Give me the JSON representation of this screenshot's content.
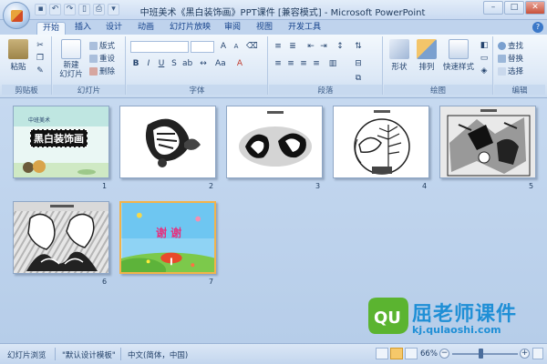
{
  "window": {
    "title": "中班美术《黑白装饰画》PPT课件 [兼容模式] - Microsoft PowerPoint"
  },
  "tabs": [
    {
      "label": "开始",
      "active": true
    },
    {
      "label": "插入"
    },
    {
      "label": "设计"
    },
    {
      "label": "动画"
    },
    {
      "label": "幻灯片放映"
    },
    {
      "label": "审阅"
    },
    {
      "label": "视图"
    },
    {
      "label": "开发工具"
    }
  ],
  "ribbon": {
    "clipboard": {
      "label": "剪贴板",
      "paste": "粘贴"
    },
    "slides": {
      "label": "幻灯片",
      "new_slide": "新建\n幻灯片",
      "layout": "版式",
      "reset": "重设",
      "delete": "删除"
    },
    "font": {
      "label": "字体",
      "font_name": "",
      "font_size": ""
    },
    "paragraph": {
      "label": "段落"
    },
    "drawing": {
      "label": "绘图",
      "shapes": "形状",
      "arrange": "排列",
      "quick_styles": "快速样式"
    },
    "editing": {
      "label": "编辑",
      "find": "查找",
      "replace": "替换",
      "select": "选择"
    }
  },
  "slides": [
    {
      "number": "1",
      "title": "中班美术",
      "main_text": "黑白装饰画",
      "selected": false
    },
    {
      "number": "2",
      "selected": false
    },
    {
      "number": "3",
      "selected": false
    },
    {
      "number": "4",
      "selected": false
    },
    {
      "number": "5",
      "selected": false
    },
    {
      "number": "6",
      "selected": false
    },
    {
      "number": "7",
      "main_text": "谢 谢",
      "selected": true
    }
  ],
  "watermark": {
    "logo": "QU",
    "text": "屈老师课件",
    "url": "kj.qulaoshi.com"
  },
  "statusbar": {
    "view_name": "幻灯片浏览",
    "theme": "\"默认设计模板\"",
    "language": "中文(简体，中国)",
    "zoom": "66%"
  },
  "colors": {
    "ribbon_bg": "#dce8f6",
    "sorter_bg": "#c6d9f0",
    "selection": "#f2b34a",
    "accent": "#15428b"
  }
}
